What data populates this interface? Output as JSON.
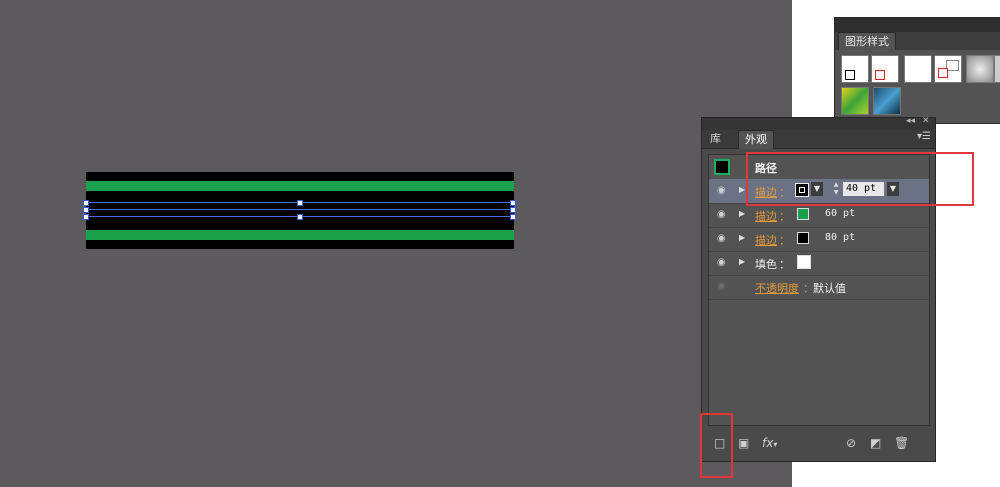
{
  "graphic_styles": {
    "tab_label": "图形样式"
  },
  "appearance": {
    "tabs": [
      "库",
      "外观"
    ],
    "path_label": "路径",
    "stroke_1": {
      "label": "描边",
      "colon": "：",
      "value": "40 pt"
    },
    "stroke_2": {
      "label": "描边",
      "colon": "：",
      "value": "60 pt",
      "color": "#18a04b"
    },
    "stroke_3": {
      "label": "描边",
      "colon": "：",
      "value": "80 pt",
      "color": "#000000"
    },
    "fill": {
      "label": "填色",
      "colon": "：",
      "color": "#ffffff"
    },
    "opacity": {
      "label": "不透明度",
      "colon": "：",
      "value": "默认值"
    },
    "menu_icon": "panel-menu-icon",
    "fx_label": "fx"
  },
  "artwork": {
    "outer_color": "#000000",
    "green_color": "#18a04b",
    "inner_color": "#000000",
    "path_color": "#4a6be0"
  }
}
